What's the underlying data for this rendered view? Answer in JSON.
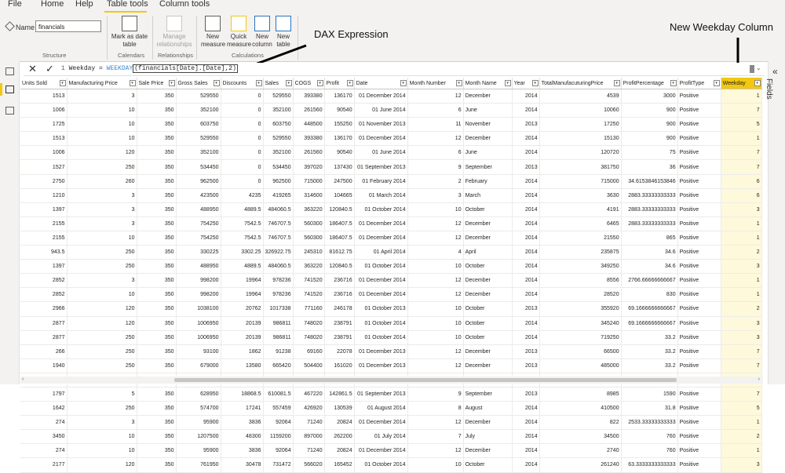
{
  "menu": [
    "File",
    "Home",
    "Help",
    "Table tools",
    "Column tools"
  ],
  "ribbon": {
    "name_label": "Name",
    "name_value": "financials",
    "mark_as_date_table": "Mark as date table",
    "manage_relationships": "Manage relationships",
    "new_measure": "New measure",
    "quick_measure": "Quick measure",
    "new_column": "New column",
    "new_table": "New table",
    "groups": {
      "structure": "Structure",
      "calendars": "Calendars",
      "relationships": "Relationships",
      "calculations": "Calculations"
    }
  },
  "annotations": {
    "dax": "DAX Expression",
    "new_column": "New Weekday Column"
  },
  "formula": {
    "line_no": "1",
    "prefix": "Weekday = ",
    "fn": "WEEKDAY",
    "args": "(financials[Date].[Date],2)"
  },
  "side": {
    "fields": "Fields"
  },
  "columns": [
    "Units Sold",
    "Manufacturing Price",
    "Sale Price",
    "Gross Sales",
    "Discounts",
    "Sales",
    "COGS",
    "Profit",
    "Date",
    "Month Number",
    "Month Name",
    "Year",
    "TotalManufacuturingPrice",
    "ProfitPercentage",
    "ProfitType",
    "Weekday"
  ],
  "rows": [
    [
      "1513",
      "3",
      "350",
      "529550",
      "0",
      "529550",
      "393380",
      "136170",
      "01 December 2014",
      "12",
      "December",
      "2014",
      "4539",
      "3000",
      "Positive",
      "1"
    ],
    [
      "1006",
      "10",
      "350",
      "352100",
      "0",
      "352100",
      "261560",
      "90540",
      "01 June 2014",
      "6",
      "June",
      "2014",
      "10060",
      "900",
      "Positive",
      "7"
    ],
    [
      "1725",
      "10",
      "350",
      "603750",
      "0",
      "603750",
      "448500",
      "155250",
      "01 November 2013",
      "11",
      "November",
      "2013",
      "17250",
      "900",
      "Positive",
      "5"
    ],
    [
      "1513",
      "10",
      "350",
      "529550",
      "0",
      "529550",
      "393380",
      "136170",
      "01 December 2014",
      "12",
      "December",
      "2014",
      "15130",
      "900",
      "Positive",
      "1"
    ],
    [
      "1006",
      "120",
      "350",
      "352100",
      "0",
      "352100",
      "261560",
      "90540",
      "01 June 2014",
      "6",
      "June",
      "2014",
      "120720",
      "75",
      "Positive",
      "7"
    ],
    [
      "1527",
      "250",
      "350",
      "534450",
      "0",
      "534450",
      "397020",
      "137430",
      "01 September 2013",
      "9",
      "September",
      "2013",
      "381750",
      "36",
      "Positive",
      "7"
    ],
    [
      "2750",
      "260",
      "350",
      "962500",
      "0",
      "962500",
      "715000",
      "247500",
      "01 February 2014",
      "2",
      "February",
      "2014",
      "715000",
      "34.6153846153846",
      "Positive",
      "6"
    ],
    [
      "1210",
      "3",
      "350",
      "423500",
      "4235",
      "419265",
      "314600",
      "104665",
      "01 March 2014",
      "3",
      "March",
      "2014",
      "3630",
      "2883.33333333333",
      "Positive",
      "6"
    ],
    [
      "1397",
      "3",
      "350",
      "488950",
      "4889.5",
      "484060.5",
      "363220",
      "120840.5",
      "01 October 2014",
      "10",
      "October",
      "2014",
      "4191",
      "2883.33333333333",
      "Positive",
      "3"
    ],
    [
      "2155",
      "3",
      "350",
      "754250",
      "7542.5",
      "746707.5",
      "560300",
      "186407.5",
      "01 December 2014",
      "12",
      "December",
      "2014",
      "6465",
      "2883.33333333333",
      "Positive",
      "1"
    ],
    [
      "2155",
      "10",
      "350",
      "754250",
      "7542.5",
      "746707.5",
      "560300",
      "186407.5",
      "01 December 2014",
      "12",
      "December",
      "2014",
      "21550",
      "865",
      "Positive",
      "1"
    ],
    [
      "943.5",
      "250",
      "350",
      "330225",
      "3302.25",
      "326922.75",
      "245310",
      "81612.75",
      "01 April 2014",
      "4",
      "April",
      "2014",
      "235875",
      "34.6",
      "Positive",
      "2"
    ],
    [
      "1397",
      "250",
      "350",
      "488950",
      "4889.5",
      "484060.5",
      "363220",
      "120840.5",
      "01 October 2014",
      "10",
      "October",
      "2014",
      "349250",
      "34.6",
      "Positive",
      "3"
    ],
    [
      "2852",
      "3",
      "350",
      "998200",
      "19964",
      "978236",
      "741520",
      "236716",
      "01 December 2014",
      "12",
      "December",
      "2014",
      "8556",
      "2766.66666666667",
      "Positive",
      "1"
    ],
    [
      "2852",
      "10",
      "350",
      "998200",
      "19964",
      "978236",
      "741520",
      "236716",
      "01 December 2014",
      "12",
      "December",
      "2014",
      "28520",
      "830",
      "Positive",
      "1"
    ],
    [
      "2966",
      "120",
      "350",
      "1038100",
      "20762",
      "1017338",
      "771160",
      "246178",
      "01 October 2013",
      "10",
      "October",
      "2013",
      "355920",
      "69.1666666666667",
      "Positive",
      "2"
    ],
    [
      "2877",
      "120",
      "350",
      "1006950",
      "20139",
      "986811",
      "748020",
      "238791",
      "01 October 2014",
      "10",
      "October",
      "2014",
      "345240",
      "69.1666666666667",
      "Positive",
      "3"
    ],
    [
      "2877",
      "250",
      "350",
      "1006950",
      "20139",
      "986811",
      "748020",
      "238791",
      "01 October 2014",
      "10",
      "October",
      "2014",
      "719250",
      "33.2",
      "Positive",
      "3"
    ],
    [
      "266",
      "250",
      "350",
      "93100",
      "1862",
      "91238",
      "69160",
      "22078",
      "01 December 2013",
      "12",
      "December",
      "2013",
      "66500",
      "33.2",
      "Positive",
      "7"
    ],
    [
      "1940",
      "250",
      "350",
      "679000",
      "13580",
      "665420",
      "504400",
      "161020",
      "01 December 2013",
      "12",
      "December",
      "2013",
      "485000",
      "33.2",
      "Positive",
      "7"
    ],
    [
      "2966",
      "260",
      "350",
      "1038100",
      "20762",
      "1017338",
      "771160",
      "246178",
      "01 October 2013",
      "10",
      "October",
      "2013",
      "771160",
      "31.9230769230769",
      "Positive",
      "2"
    ],
    [
      "1797",
      "5",
      "350",
      "628950",
      "18868.5",
      "610081.5",
      "467220",
      "142861.5",
      "01 September 2013",
      "9",
      "September",
      "2013",
      "8985",
      "1590",
      "Positive",
      "7"
    ],
    [
      "1642",
      "250",
      "350",
      "574700",
      "17241",
      "557459",
      "426920",
      "130539",
      "01 August 2014",
      "8",
      "August",
      "2014",
      "410500",
      "31.8",
      "Positive",
      "5"
    ],
    [
      "274",
      "3",
      "350",
      "95900",
      "3836",
      "92064",
      "71240",
      "20824",
      "01 December 2014",
      "12",
      "December",
      "2014",
      "822",
      "2533.33333333333",
      "Positive",
      "1"
    ],
    [
      "3450",
      "10",
      "350",
      "1207500",
      "48300",
      "1159200",
      "897000",
      "262200",
      "01 July 2014",
      "7",
      "July",
      "2014",
      "34500",
      "760",
      "Positive",
      "2"
    ],
    [
      "274",
      "10",
      "350",
      "95900",
      "3836",
      "92064",
      "71240",
      "20824",
      "01 December 2014",
      "12",
      "December",
      "2014",
      "2740",
      "760",
      "Positive",
      "1"
    ],
    [
      "2177",
      "120",
      "350",
      "761950",
      "30478",
      "731472",
      "566020",
      "165452",
      "01 October 2014",
      "10",
      "October",
      "2014",
      "261240",
      "63.3333333333333",
      "Positive",
      "3"
    ]
  ]
}
